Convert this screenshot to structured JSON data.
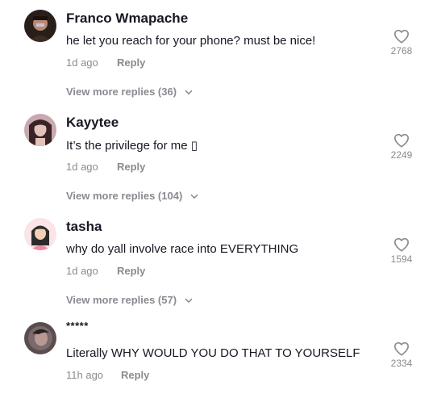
{
  "comments": [
    {
      "username": "Franco Wmapache",
      "text": "he let you reach for your phone? must be nice!",
      "time": "1d ago",
      "reply_label": "Reply",
      "likes": "2768",
      "more_replies": "View more replies (36)"
    },
    {
      "username": "Kayytee",
      "text": "It’s the privilege for me ▯",
      "time": "1d ago",
      "reply_label": "Reply",
      "likes": "2249",
      "more_replies": "View more replies (104)"
    },
    {
      "username": "tasha",
      "text": "why do yall involve race into EVERYTHING",
      "time": "1d ago",
      "reply_label": "Reply",
      "likes": "1594",
      "more_replies": "View more replies (57)"
    },
    {
      "username": "*****",
      "text": "Literally WHY WOULD YOU DO THAT TO YOURSELF",
      "time": "11h ago",
      "reply_label": "Reply",
      "likes": "2334"
    }
  ],
  "icons": {
    "like": "heart-outline-icon",
    "expand": "chevron-down-icon"
  },
  "colors": {
    "text_primary": "#161823",
    "text_secondary": "#8a8b91"
  }
}
